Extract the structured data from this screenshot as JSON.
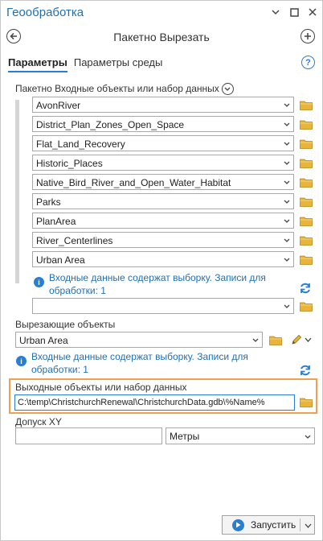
{
  "window": {
    "title": "Геообработка"
  },
  "tool": {
    "title": "Пакетно Вырезать"
  },
  "tabs": [
    {
      "label": "Параметры"
    },
    {
      "label": "Параметры среды"
    }
  ],
  "batch_input": {
    "label": "Пакетно Входные объекты или набор данных",
    "items": [
      {
        "value": "AvonRiver"
      },
      {
        "value": "District_Plan_Zones_Open_Space"
      },
      {
        "value": "Flat_Land_Recovery"
      },
      {
        "value": "Historic_Places"
      },
      {
        "value": "Native_Bird_River_and_Open_Water_Habitat"
      },
      {
        "value": "Parks"
      },
      {
        "value": "PlanArea"
      },
      {
        "value": "River_Centerlines"
      },
      {
        "value": "Urban Area"
      }
    ],
    "info_line1": "Входные данные содержат выборку. Записи для",
    "info_line2": "обработки: 1",
    "empty_value": ""
  },
  "clip_features": {
    "label": "Вырезающие объекты",
    "value": "Urban Area",
    "info_line1": "Входные данные содержат выборку. Записи для",
    "info_line2": "обработки: 1"
  },
  "output": {
    "label": "Выходные объекты или набор данных",
    "value": "C:\\temp\\ChristchurchRenewal\\ChristchurchData.gdb\\%Name%"
  },
  "xy_tolerance": {
    "label": "Допуск XY",
    "value": "",
    "unit": "Метры"
  },
  "run": {
    "label": "Запустить"
  },
  "colors": {
    "accent": "#2a7ed2",
    "highlight": "#f0a050",
    "folder": "#e8b43a"
  }
}
